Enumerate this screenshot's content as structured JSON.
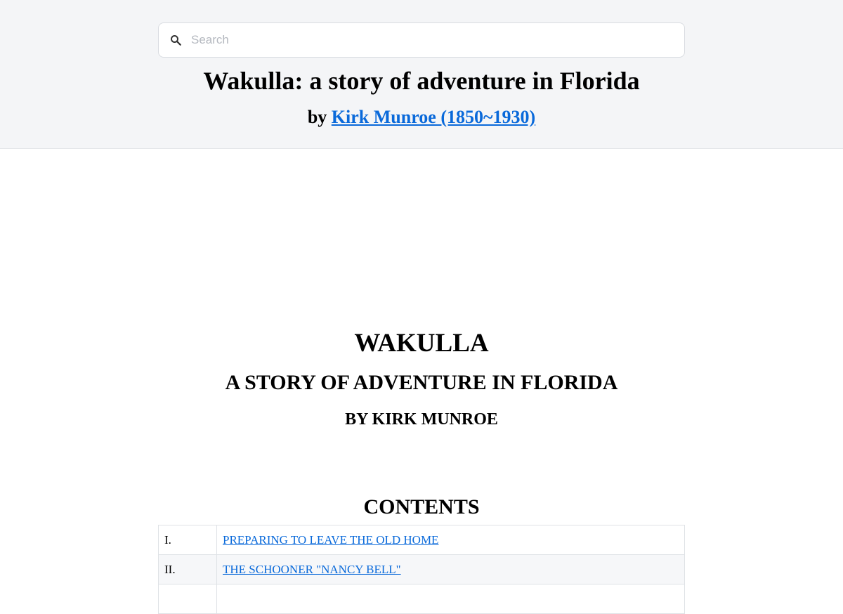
{
  "search": {
    "placeholder": "Search"
  },
  "book": {
    "title": "Wakulla: a story of adventure in Florida",
    "by_prefix": "by",
    "author_link": "Kirk Munroe (1850~1930)"
  },
  "text": {
    "heading": "WAKULLA",
    "subheading": "A STORY OF ADVENTURE IN FLORIDA",
    "author_line": "BY KIRK MUNROE",
    "contents_heading": "CONTENTS"
  },
  "toc": [
    {
      "num": "I.",
      "title": "PREPARING TO LEAVE THE OLD HOME"
    },
    {
      "num": "II.",
      "title": "THE SCHOONER \"NANCY BELL\""
    },
    {
      "num": "",
      "title": ""
    }
  ],
  "colors": {
    "link": "#0969da",
    "header_bg": "#f4f5f7"
  },
  "icons": {
    "search": "search-icon"
  }
}
